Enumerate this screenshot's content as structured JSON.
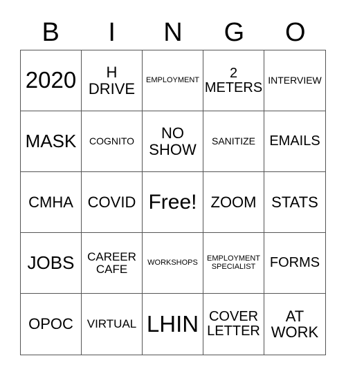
{
  "header": [
    "B",
    "I",
    "N",
    "G",
    "O"
  ],
  "cells": [
    [
      "2020",
      "H DRIVE",
      "EMPLOYMENT",
      "2 METERS",
      "INTERVIEW"
    ],
    [
      "MASK",
      "COGNITO",
      "NO SHOW",
      "SANITIZE",
      "EMAILS"
    ],
    [
      "CMHA",
      "COVID",
      "Free!",
      "ZOOM",
      "STATS"
    ],
    [
      "JOBS",
      "CAREER CAFE",
      "WORKSHOPS",
      "EMPLOYMENT SPECIALIST",
      "FORMS"
    ],
    [
      "OPOC",
      "VIRTUAL",
      "LHIN",
      "COVER LETTER",
      "AT WORK"
    ]
  ]
}
